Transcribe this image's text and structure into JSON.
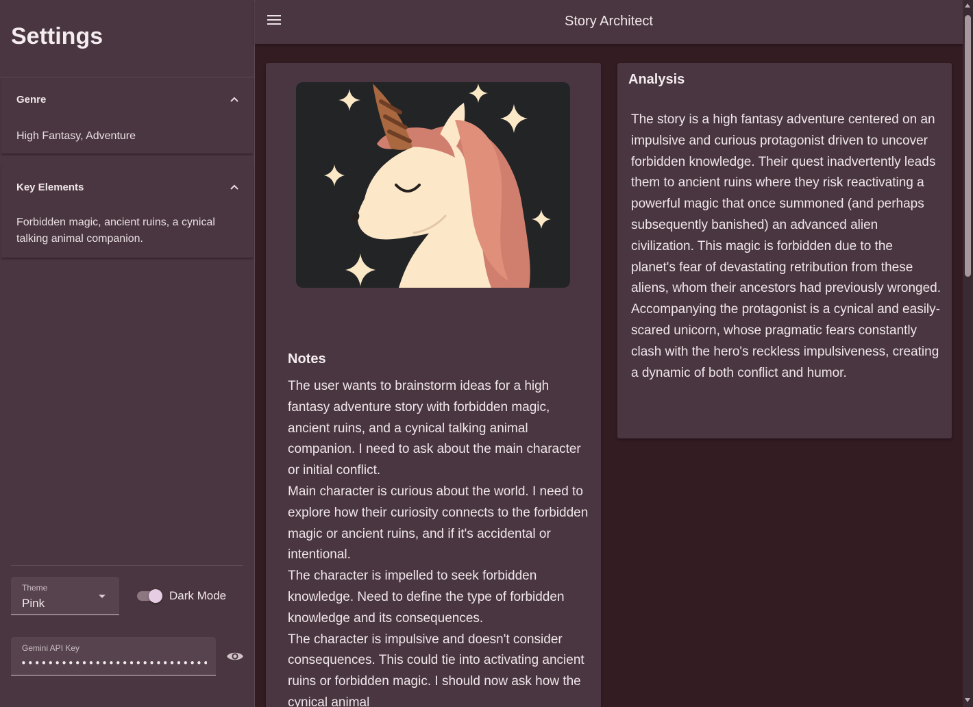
{
  "sidebar": {
    "title": "Settings",
    "genre": {
      "label": "Genre",
      "value": "High Fantasy, Adventure"
    },
    "key_elements": {
      "label": "Key Elements",
      "value": "Forbidden magic, ancient ruins, a cynical talking animal companion."
    },
    "theme": {
      "label": "Theme",
      "value": "Pink"
    },
    "dark_mode": {
      "label": "Dark Mode",
      "enabled": true
    },
    "api_key": {
      "label": "Gemini API Key",
      "value": "••••••••••••••••••••••••••••"
    }
  },
  "appbar": {
    "title": "Story Architect"
  },
  "notes": {
    "title": "Notes",
    "paragraphs": [
      "The user wants to brainstorm ideas for a high fantasy adventure story with forbidden magic, ancient ruins, and a cynical talking animal companion. I need to ask about the main character or initial conflict.",
      "Main character is curious about the world. I need to explore how their curiosity connects to the forbidden magic or ancient ruins, and if it's accidental or intentional.",
      "The character is impelled to seek forbidden knowledge. Need to define the type of forbidden knowledge and its consequences.",
      "The character is impulsive and doesn't consider consequences. This could tie into activating ancient ruins or forbidden magic. I should now ask how the cynical animal"
    ]
  },
  "analysis": {
    "title": "Analysis",
    "text": "The story is a high fantasy adventure centered on an impulsive and curious protagonist driven to uncover forbidden knowledge. Their quest inadvertently leads them to ancient ruins where they risk reactivating a powerful magic that once summoned (and perhaps subsequently banished) an advanced alien civilization. This magic is forbidden due to the planet's fear of devastating retribution from these aliens, whom their ancestors had previously wronged. Accompanying the protagonist is a cynical and easily-scared unicorn, whose pragmatic fears constantly clash with the hero's reckless impulsiveness, creating a dynamic of both conflict and humor."
  },
  "colors": {
    "background": "#341c23",
    "surface": "#4a3640",
    "accent_toggle": "#e6cde4"
  }
}
